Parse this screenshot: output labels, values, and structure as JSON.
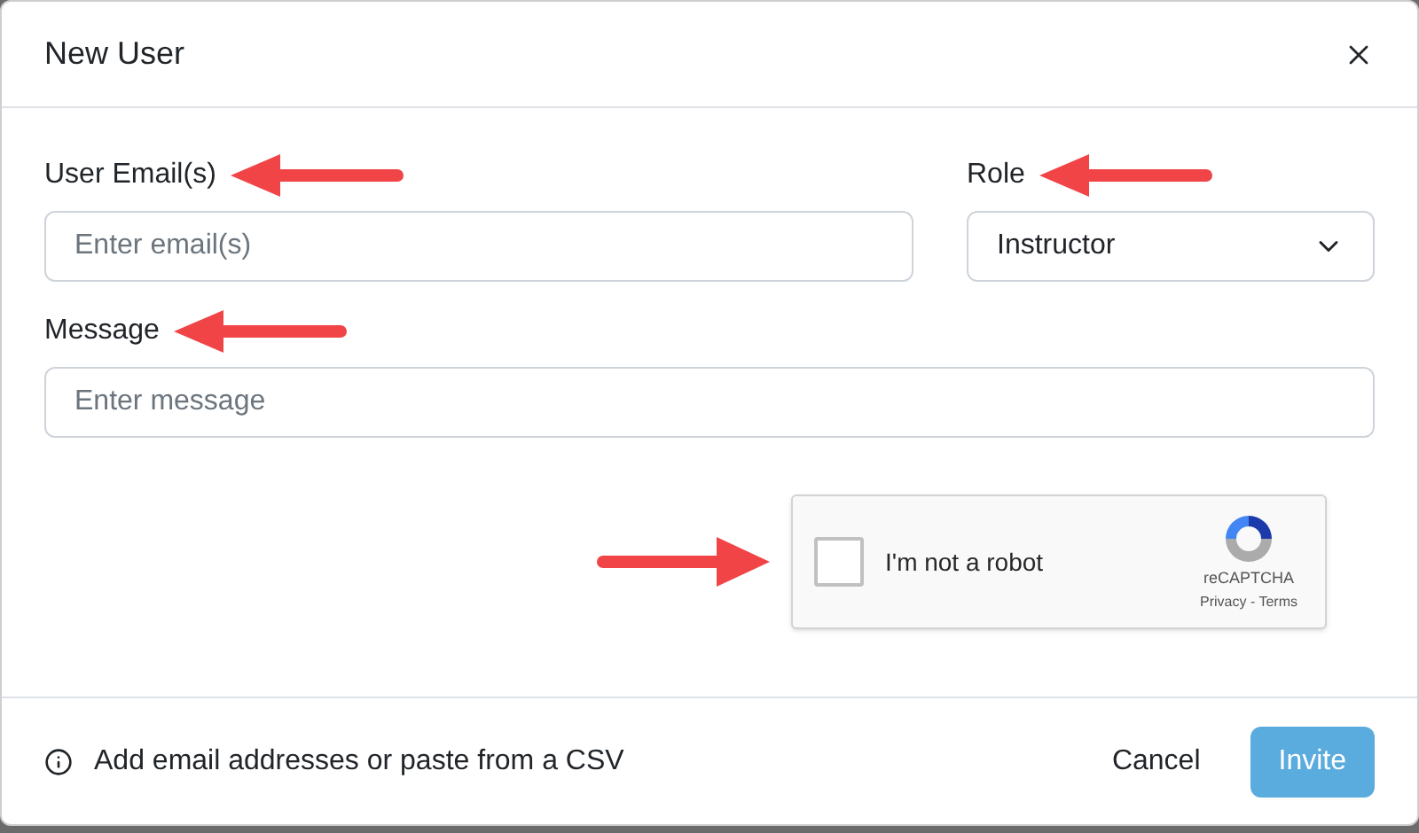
{
  "dialog": {
    "title": "New User"
  },
  "fields": {
    "email": {
      "label": "User Email(s)",
      "placeholder": "Enter email(s)"
    },
    "role": {
      "label": "Role",
      "value": "Instructor"
    },
    "message": {
      "label": "Message",
      "placeholder": "Enter message"
    }
  },
  "captcha": {
    "label": "I'm not a robot",
    "checked": false,
    "brand": "reCAPTCHA",
    "privacy": "Privacy",
    "separator": "-",
    "terms": "Terms"
  },
  "footer": {
    "hint": "Add email addresses or paste from a CSV",
    "buttons": [
      "Cancel",
      "Invite"
    ]
  }
}
